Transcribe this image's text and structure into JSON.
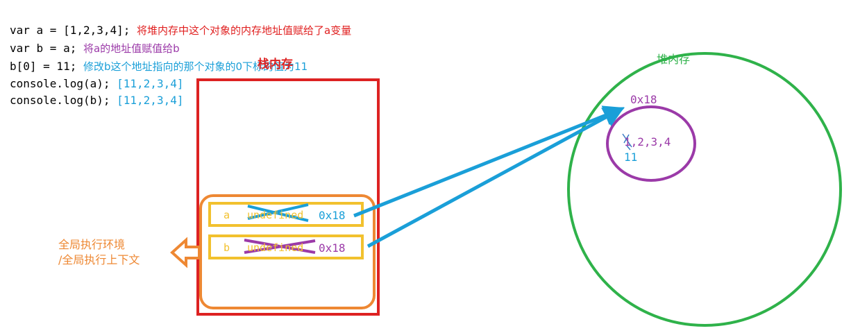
{
  "code_lines": [
    {
      "code": "var a = [1,2,3,4];",
      "comment": "将堆内存中这个对象的内存地址值赋给了a变量"
    },
    {
      "code": "var b = a;",
      "comment": "将a的地址值赋值给b"
    },
    {
      "code": "b[0] = 11;",
      "comment": "修改b这个地址指向的那个对象的0下标的值为11"
    },
    {
      "code": "console.log(a);",
      "comment": "[11,2,3,4]"
    },
    {
      "code": "console.log(b);",
      "comment": "[11,2,3,4]"
    }
  ],
  "stack": {
    "title": "栈内存",
    "context_label_1": "全局执行环境",
    "context_label_2": "/全局执行上下文",
    "var_a": {
      "name": "a",
      "old_value": "undefined",
      "new_value": "0x18"
    },
    "var_b": {
      "name": "b",
      "old_value": "undefined",
      "new_value": "0x18"
    }
  },
  "heap": {
    "title": "堆内存",
    "address": "0x18",
    "array_text": "1,2,3,4",
    "new_value": "11"
  },
  "colors": {
    "stack_border": "#dd2222",
    "context_border": "#ee8833",
    "var_border": "#f2c12e",
    "heap_circle": "#2fb24a",
    "object_circle": "#9b3aa8",
    "arrow": "#1a9fd8",
    "cross_a": "#1a9fd8",
    "cross_b": "#9b3aa8"
  }
}
